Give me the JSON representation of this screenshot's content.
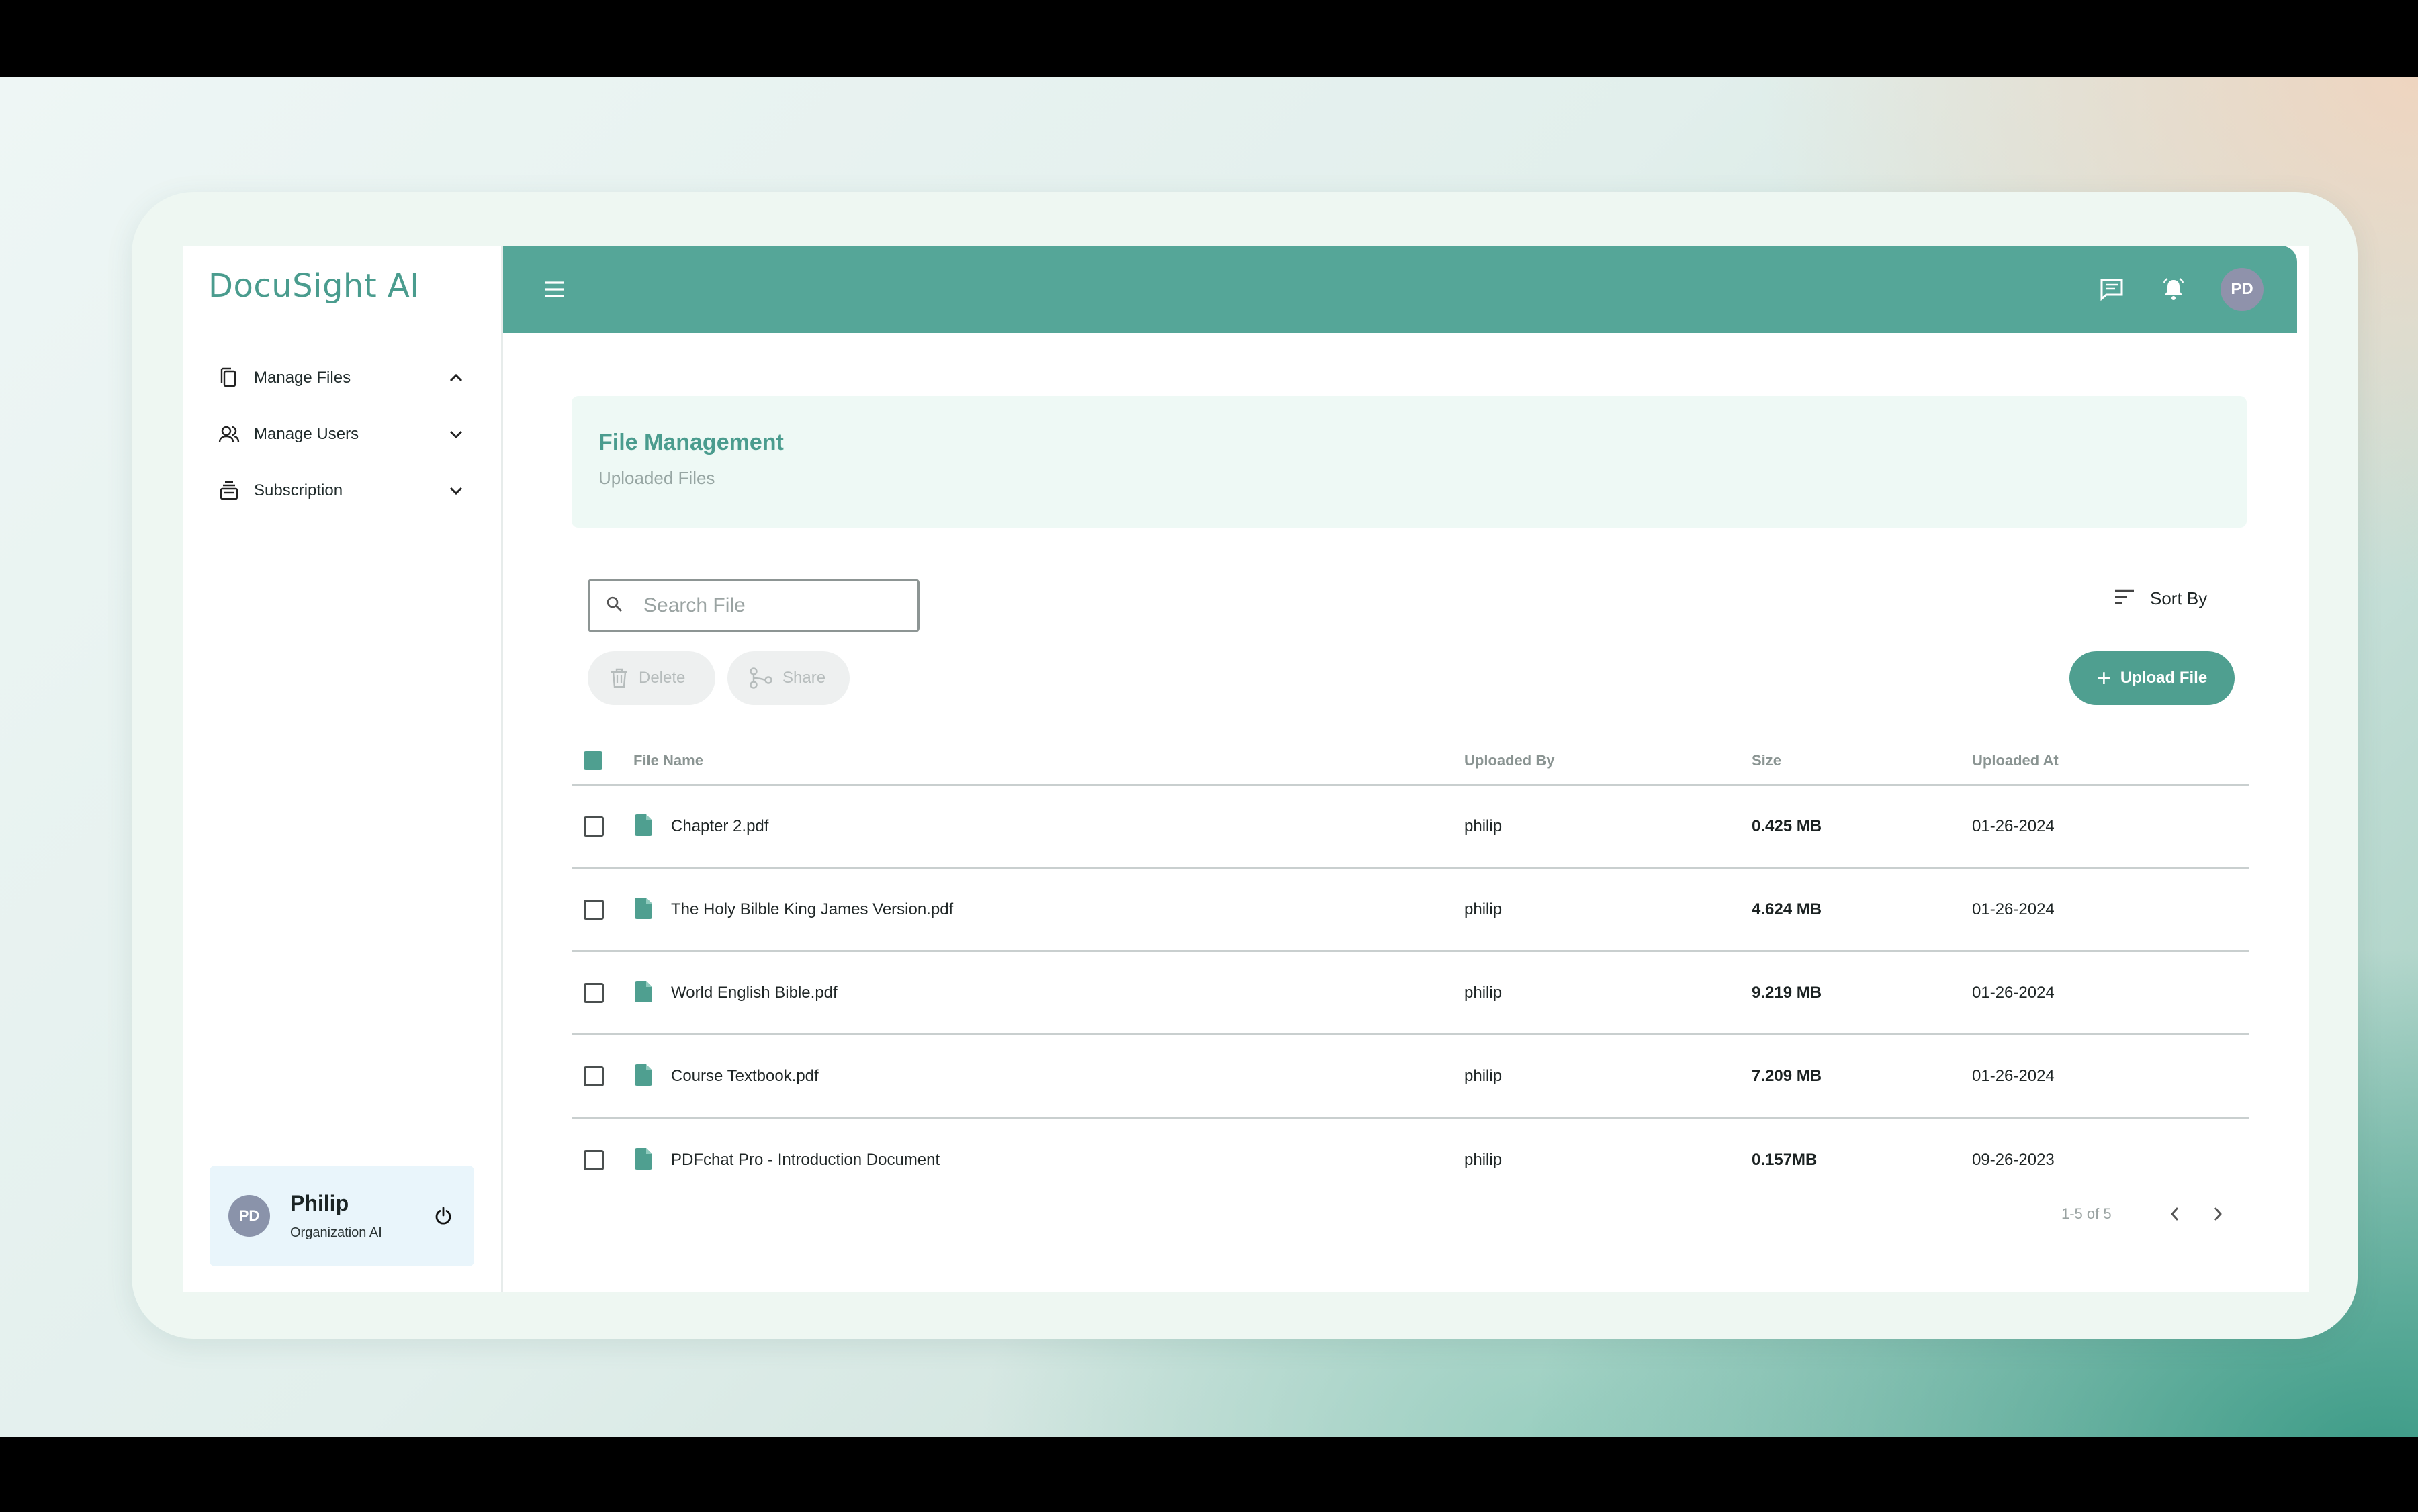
{
  "app": {
    "logo": "DocuSight AI"
  },
  "sidebar": {
    "items": [
      {
        "label": "Manage Files",
        "icon": "files-icon",
        "chevron": "chevron-up-icon"
      },
      {
        "label": "Manage Users",
        "icon": "users-icon",
        "chevron": "chevron-down-icon"
      },
      {
        "label": "Subscription",
        "icon": "subscription-icon",
        "chevron": "chevron-down-icon"
      }
    ],
    "user": {
      "initials": "PD",
      "name": "Philip",
      "org": "Organization AI"
    }
  },
  "topbar": {
    "avatar_initials": "PD"
  },
  "header": {
    "title": "File Management",
    "subtitle": "Uploaded Files"
  },
  "toolbar": {
    "search_placeholder": "Search File",
    "sort_label": "Sort By",
    "delete_label": "Delete",
    "share_label": "Share",
    "upload_label": "Upload File"
  },
  "table": {
    "columns": [
      "File Name",
      "Uploaded By",
      "Size",
      "Uploaded At"
    ],
    "rows": [
      {
        "name": "Chapter 2.pdf",
        "by": "philip",
        "size": "0.425 MB",
        "date": "01-26-2024"
      },
      {
        "name": "The Holy Bilble King James Version.pdf",
        "by": "philip",
        "size": "4.624 MB",
        "date": "01-26-2024"
      },
      {
        "name": "World English Bible.pdf",
        "by": "philip",
        "size": "9.219 MB",
        "date": "01-26-2024"
      },
      {
        "name": "Course Textbook.pdf",
        "by": "philip",
        "size": "7.209 MB",
        "date": "01-26-2024"
      },
      {
        "name": "PDFchat Pro - Introduction Document",
        "by": "philip",
        "size": "0.157MB",
        "date": "09-26-2023"
      }
    ]
  },
  "pagination": {
    "range": "1-5 of 5"
  },
  "colors": {
    "accent": "#4f9f90",
    "topbar": "#55a698",
    "title": "#4a9c8e"
  }
}
